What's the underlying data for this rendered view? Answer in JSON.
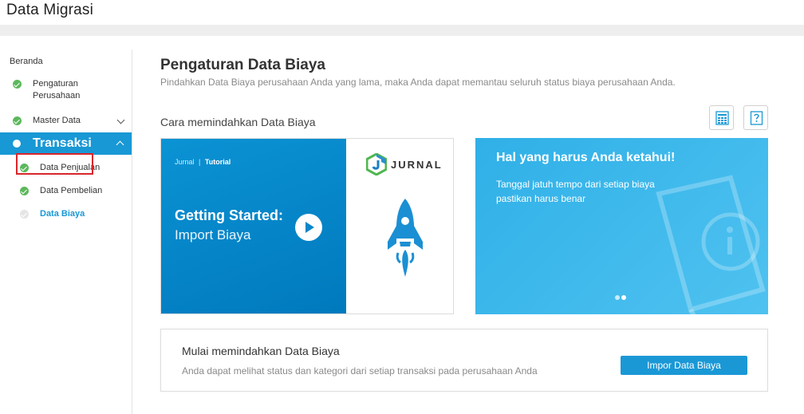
{
  "app": {
    "title": "Data Migrasi"
  },
  "sidebar": {
    "home": "Beranda",
    "items": [
      {
        "label_line1": "Pengaturan",
        "label_line2": "Perusahaan",
        "status": "done"
      },
      {
        "label": "Master Data",
        "status": "done",
        "expandable": true
      },
      {
        "label": "Transaksi",
        "status": "active",
        "expanded": true
      },
      {
        "label": "Data Penjualan",
        "status": "done"
      },
      {
        "label": "Data Pembelian",
        "status": "done"
      },
      {
        "label": "Data Biaya",
        "status": "current"
      }
    ]
  },
  "main": {
    "title": "Pengaturan Data Biaya",
    "subtitle": "Pindahkan Data Biaya perusahaan Anda yang lama, maka Anda dapat memantau seluruh status biaya perusahaan Anda.",
    "section_label": "Cara memindahkan Data Biaya",
    "icons": [
      "spreadsheet-icon",
      "help-icon"
    ],
    "video": {
      "tag_brand": "Jurnal",
      "tag_sep": "|",
      "tag_label": "Tutorial",
      "title": "Getting Started:",
      "subtitle": "Import Biaya",
      "logo_text": "JURNAL"
    },
    "info": {
      "title": "Hal yang harus Anda ketahui!",
      "text": "Tanggal jatuh tempo dari setiap biaya pastikan harus benar"
    },
    "start": {
      "title": "Mulai memindahkan Data Biaya",
      "description": "Anda dapat melihat status dan kategori dari setiap transaksi pada perusahaan Anda",
      "button": "Impor Data Biaya"
    }
  },
  "colors": {
    "accent": "#1898d5",
    "check": "#5cb85c",
    "highlight": "#d9262c",
    "info_card": "#3db8ec"
  }
}
